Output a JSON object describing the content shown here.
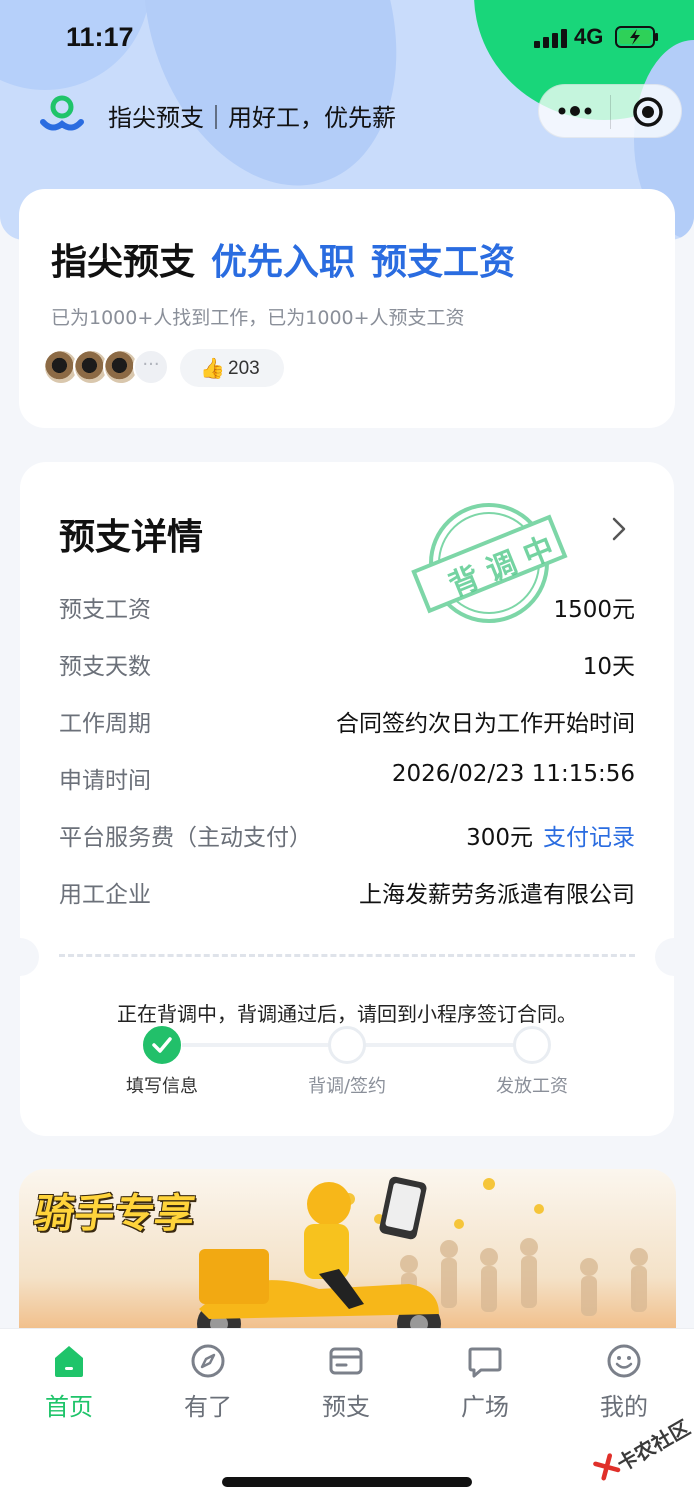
{
  "status": {
    "time": "11:17",
    "network": "4G"
  },
  "nav": {
    "title": "指尖预支｜用好工，优先薪"
  },
  "hero": {
    "title_black": "指尖预支",
    "title_blue1": "优先入职",
    "title_blue2": "预支工资",
    "subtitle": "已为1000+人找到工作，已为1000+人预支工资",
    "avatars_more": "···",
    "likes": "203"
  },
  "detail": {
    "title": "预支详情",
    "stamp_text": "背调中",
    "rows": [
      {
        "label": "预支工资",
        "value": "1500元"
      },
      {
        "label": "预支天数",
        "value": "10天"
      },
      {
        "label": "工作周期",
        "value": "合同签约次日为工作开始时间"
      },
      {
        "label": "申请时间",
        "value": "2026/02/23 11:15:56"
      },
      {
        "label": "平台服务费（主动支付）",
        "value": "300元",
        "link": "支付记录"
      },
      {
        "label": "用工企业",
        "value": "上海发薪劳务派遣有限公司"
      }
    ],
    "notice": "正在背调中，背调通过后，请回到小程序签订合同。",
    "steps": [
      {
        "label": "填写信息",
        "done": true
      },
      {
        "label": "背调/签约",
        "done": false
      },
      {
        "label": "发放工资",
        "done": false
      }
    ]
  },
  "banner": {
    "title": "骑手专享"
  },
  "tabs": [
    {
      "label": "首页",
      "icon": "home-icon",
      "active": true
    },
    {
      "label": "有了",
      "icon": "compass-icon",
      "active": false
    },
    {
      "label": "预支",
      "icon": "wallet-icon",
      "active": false
    },
    {
      "label": "广场",
      "icon": "chat-icon",
      "active": false
    },
    {
      "label": "我的",
      "icon": "smile-icon",
      "active": false
    }
  ],
  "watermark": "卡农社区",
  "colors": {
    "brand_green": "#1fc46a",
    "link_blue": "#2a6ce0",
    "stamp_green": "#52c98a"
  }
}
